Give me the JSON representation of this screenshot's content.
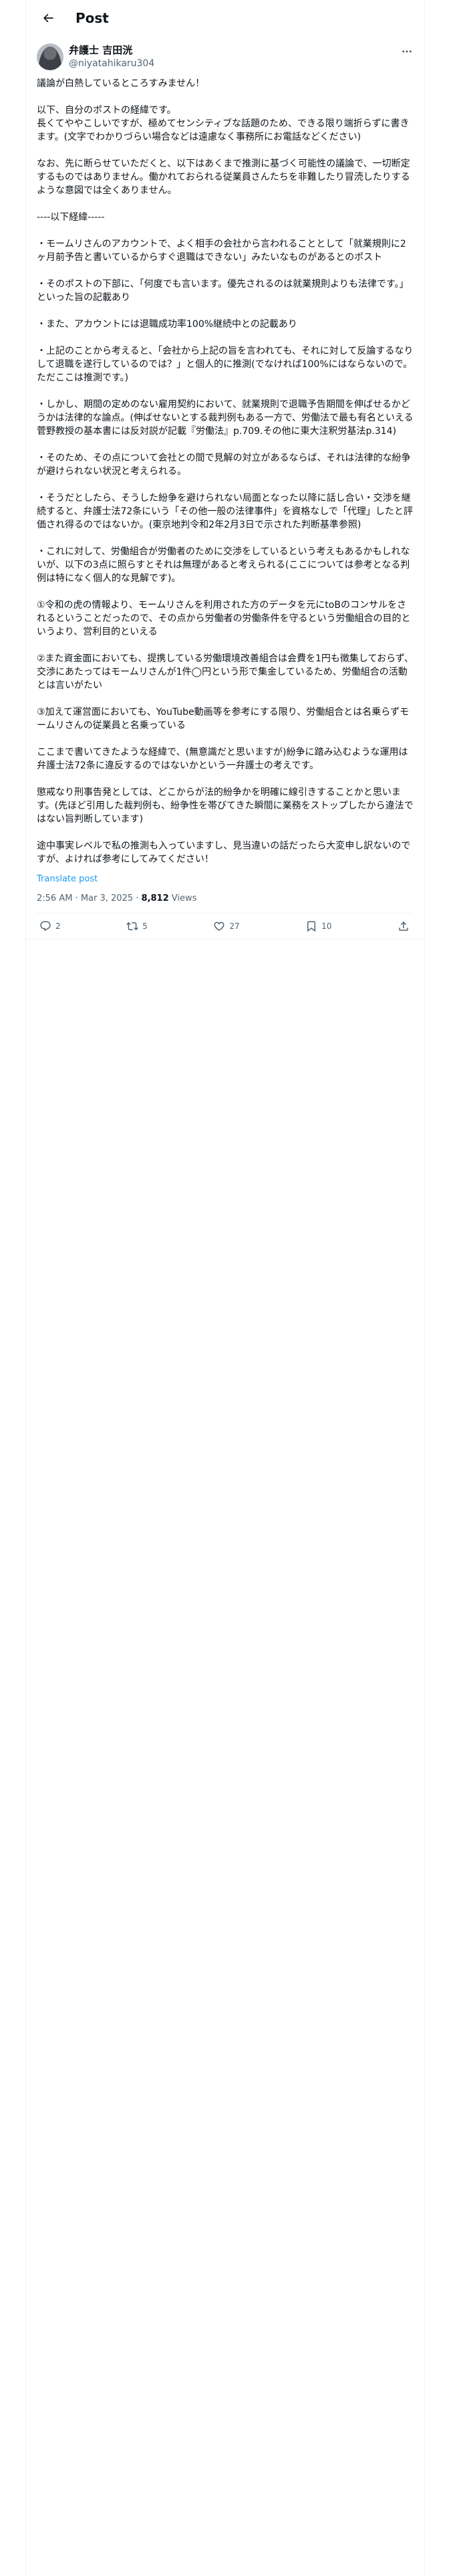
{
  "header": {
    "title": "Post"
  },
  "author": {
    "name": "弁護士 吉田洸",
    "handle": "@niyatahikaru304"
  },
  "post": {
    "body": "議論が白熱しているところすみません！\n\n以下、自分のポストの経緯です。\n長くてややこしいですが、極めてセンシティブな話題のため、できる限り端折らずに書きます。(文字でわかりづらい場合などは遠慮なく事務所にお電話などください)\n\nなお、先に断らせていただくと、以下はあくまで推測に基づく可能性の議論で、一切断定するものではありません。働かれておられる従業員さんたちを非難したり冒涜したりするような意図では全くありません。\n\n----以下経緯-----\n\n・モームリさんのアカウントで、よく相手の会社から言われることとして「就業規則に2ヶ月前予告と書いているからすぐ退職はできない」みたいなものがあるとのポスト\n\n・そのポストの下部に、「何度でも言います。優先されるのは就業規則よりも法律です。」といった旨の記載あり\n\n・また、アカウントには退職成功率100%継続中との記載あり\n\n・上記のことから考えると、「会社から上記の旨を言われても、それに対して反論するなりして退職を遂行しているのでは？」と個人的に推測(でなければ100%にはならないので。ただここは推測です。)\n\n・しかし、期間の定めのない雇用契約において、就業規則で退職予告期間を伸ばせるかどうかは法律的な論点。(伸ばせないとする裁判例もある一方で、労働法で最も有名といえる菅野教授の基本書には反対説が記載『労働法』p.709.その他に東大注釈労基法p.314)\n\n・そのため、その点について会社との間で見解の対立があるならば、それは法律的な紛争が避けられない状況と考えられる。\n\n・そうだとしたら、そうした紛争を避けられない局面となった以降に話し合い・交渉を継続すると、弁護士法72条にいう「その他一般の法律事件」を資格なしで「代理」したと評価され得るのではないか。(東京地判令和2年2月3日で示された判断基準参照)\n\n・これに対して、労働組合が労働者のために交渉をしているという考えもあるかもしれないが、以下の3点に照らすとそれは無理があると考えられる(ここについては参考となる判例は特になく個人的な見解です)。\n\n①令和の虎の情報より、モームリさんを利用された方のデータを元にtoBのコンサルをされるということだったので、その点から労働者の労働条件を守るという労働組合の目的というより、営利目的といえる\n\n②また資金面においても、提携している労働環境改善組合は会費を1円も徴集しておらず、交渉にあたってはモームリさんが1件◯円という形で集金しているため、労働組合の活動とは言いがたい\n\n③加えて運営面においても、YouTube動画等を参考にする限り、労働組合とは名乗らずモームリさんの従業員と名乗っている\n\nここまで書いてきたような経緯で、(無意識だと思いますが)紛争に踏み込むような運用は弁護士法72条に違反するのではないかという一弁護士の考えです。\n\n懲戒なり刑事告発としては、どこからが法的紛争かを明確に線引きすることかと思います。(先ほど引用した裁判例も、紛争性を帯びてきた瞬間に業務をストップしたから違法ではない旨判断しています)\n\n途中事実レベルで私の推測も入っていますし、見当違いの話だったら大変申し訳ないのですが、よければ参考にしてみてください！"
  },
  "translate_label": "Translate post",
  "meta": {
    "time": "2:56 AM",
    "separator": " · ",
    "date": "Mar 3, 2025",
    "views_count": "8,812",
    "views_label": " Views"
  },
  "actions": {
    "replies": "2",
    "reposts": "5",
    "likes": "27",
    "bookmarks": "10"
  },
  "icons": [
    "back-arrow-icon",
    "more-icon",
    "reply-icon",
    "repost-icon",
    "like-icon",
    "bookmark-icon",
    "share-icon"
  ]
}
